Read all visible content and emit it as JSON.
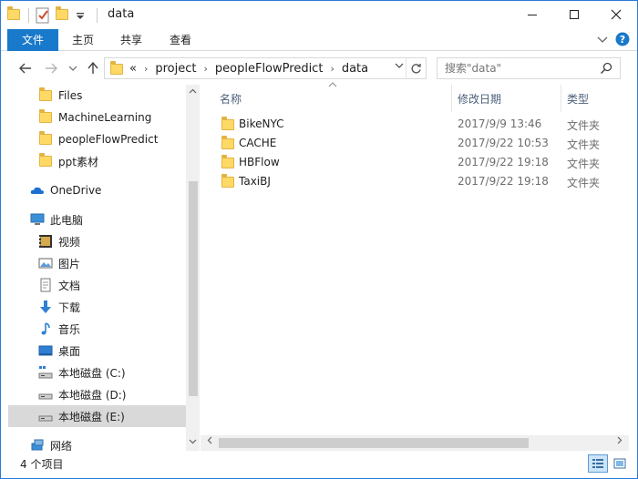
{
  "window": {
    "title": "data",
    "controls": {
      "minimize": "—",
      "maximize": "☐",
      "close": "✕"
    }
  },
  "ribbon": {
    "tabs": [
      {
        "label": "文件",
        "active": true
      },
      {
        "label": "主页"
      },
      {
        "label": "共享"
      },
      {
        "label": "查看"
      }
    ]
  },
  "address": {
    "overflow": "«",
    "path": [
      "project",
      "peopleFlowPredict",
      "data"
    ]
  },
  "search": {
    "placeholder": "搜索\"data\""
  },
  "navigation": {
    "quick_access": [
      {
        "label": "Files",
        "icon": "folder-icon"
      },
      {
        "label": "MachineLearning",
        "icon": "folder-icon"
      },
      {
        "label": "peopleFlowPredict",
        "icon": "folder-icon"
      },
      {
        "label": "ppt素材",
        "icon": "folder-icon"
      }
    ],
    "onedrive": {
      "label": "OneDrive",
      "icon": "cloud-icon"
    },
    "this_pc": {
      "label": "此电脑",
      "icon": "computer-icon"
    },
    "pc_items": [
      {
        "label": "视频",
        "icon": "video-icon"
      },
      {
        "label": "图片",
        "icon": "pictures-icon"
      },
      {
        "label": "文档",
        "icon": "documents-icon"
      },
      {
        "label": "下载",
        "icon": "download-icon"
      },
      {
        "label": "音乐",
        "icon": "music-icon"
      },
      {
        "label": "桌面",
        "icon": "desktop-icon"
      },
      {
        "label": "本地磁盘 (C:)",
        "icon": "drive-c-icon"
      },
      {
        "label": "本地磁盘 (D:)",
        "icon": "drive-icon"
      },
      {
        "label": "本地磁盘 (E:)",
        "icon": "drive-icon",
        "selected": true
      }
    ],
    "network": {
      "label": "网络",
      "icon": "network-icon"
    }
  },
  "content": {
    "columns": {
      "name": "名称",
      "modified": "修改日期",
      "type": "类型"
    },
    "files": [
      {
        "name": "BikeNYC",
        "modified": "2017/9/9 13:46",
        "type": "文件夹"
      },
      {
        "name": "CACHE",
        "modified": "2017/9/22 10:53",
        "type": "文件夹"
      },
      {
        "name": "HBFlow",
        "modified": "2017/9/22 19:18",
        "type": "文件夹"
      },
      {
        "name": "TaxiBJ",
        "modified": "2017/9/22 19:18",
        "type": "文件夹"
      }
    ]
  },
  "status": {
    "item_count": "4 个项目"
  },
  "colors": {
    "accent": "#1979ca",
    "selection": "#d9d9d9",
    "folder": "#ffd966"
  }
}
